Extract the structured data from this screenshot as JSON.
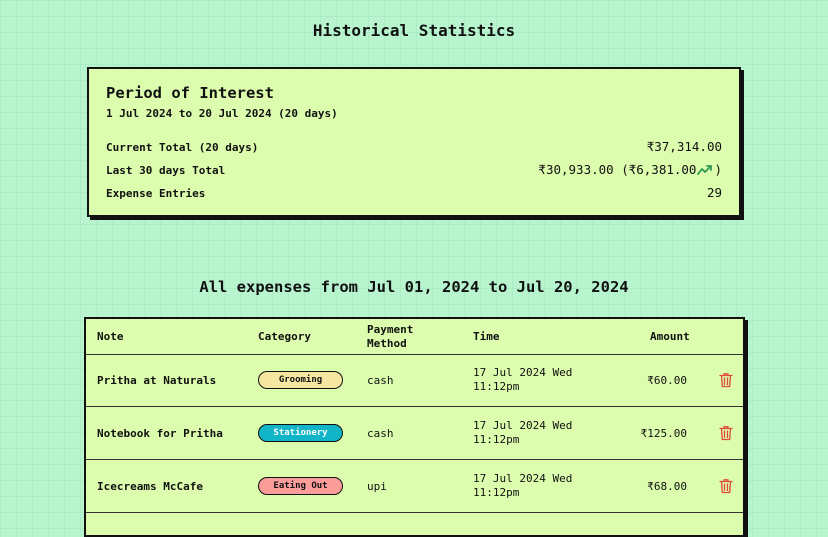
{
  "page": {
    "title": "Historical Statistics"
  },
  "summary": {
    "title": "Period of Interest",
    "range": "1 Jul 2024 to 20 Jul 2024 (20 days)",
    "stats": [
      {
        "label": "Current Total (20 days)",
        "value": "₹37,314.00"
      },
      {
        "label": "Last 30 days Total",
        "value": "₹30,933.00 (₹6,381.00",
        "value_suffix": ")",
        "icon": "trend-up-icon"
      },
      {
        "label": "Expense Entries",
        "value": "29"
      }
    ]
  },
  "expenses": {
    "title": "All expenses from Jul 01, 2024 to Jul 20, 2024",
    "columns": {
      "note": "Note",
      "category": "Category",
      "payment_line1": "Payment",
      "payment_line2": "Method",
      "time": "Time",
      "amount": "Amount"
    },
    "rows": [
      {
        "note": "Pritha at Naturals",
        "category": "Grooming",
        "category_color": "#f6e7a0",
        "category_text_color": "#111111",
        "payment": "cash",
        "time_line1": "17 Jul 2024 Wed",
        "time_line2": "11:12pm",
        "amount": "₹60.00"
      },
      {
        "note": "Notebook for Pritha",
        "category": "Stationery",
        "category_color": "#12b5c8",
        "category_text_color": "#ffffff",
        "payment": "cash",
        "time_line1": "17 Jul 2024 Wed",
        "time_line2": "11:12pm",
        "amount": "₹125.00"
      },
      {
        "note": "Icecreams McCafe",
        "category": "Eating Out",
        "category_color": "#fb9d9a",
        "category_text_color": "#111111",
        "payment": "upi",
        "time_line1": "17 Jul 2024 Wed",
        "time_line2": "11:12pm",
        "amount": "₹68.00"
      }
    ],
    "colors": {
      "delete": "#e0483c",
      "trend": "#2e9a56"
    }
  }
}
